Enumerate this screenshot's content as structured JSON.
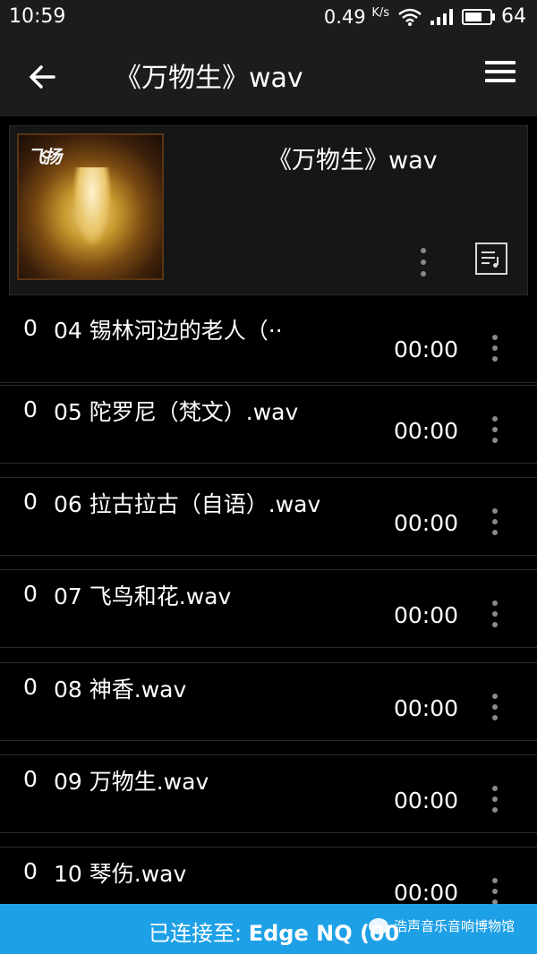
{
  "status": {
    "time": "10:59",
    "speed": "0.49",
    "speed_unit": "K/s",
    "battery": "64"
  },
  "header": {
    "title": "《万物生》wav"
  },
  "album": {
    "title": "《万物生》wav",
    "art_icon": "album-cover"
  },
  "tracks": [
    {
      "count": "0",
      "name": "04 锡林河边的老人（··",
      "duration": "00:00"
    },
    {
      "count": "0",
      "name": "05 陀罗尼（梵文）.wav",
      "duration": "00:00"
    },
    {
      "count": "0",
      "name": "06 拉古拉古（自语）.wav",
      "duration": "00:00"
    },
    {
      "count": "0",
      "name": "07 飞鸟和花.wav",
      "duration": "00:00"
    },
    {
      "count": "0",
      "name": "08 神香.wav",
      "duration": "00:00"
    },
    {
      "count": "0",
      "name": "09 万物生.wav",
      "duration": "00:00"
    },
    {
      "count": "0",
      "name": "10 琴伤.wav",
      "duration": "00:00"
    }
  ],
  "connection": {
    "prefix": "已连接至: ",
    "device": "Edge NQ (00",
    "watermark": "浩声音乐音响博物馆"
  },
  "colors": {
    "banner": "#1ea0e6",
    "background": "#000000",
    "appbar": "#1c1c1c"
  }
}
